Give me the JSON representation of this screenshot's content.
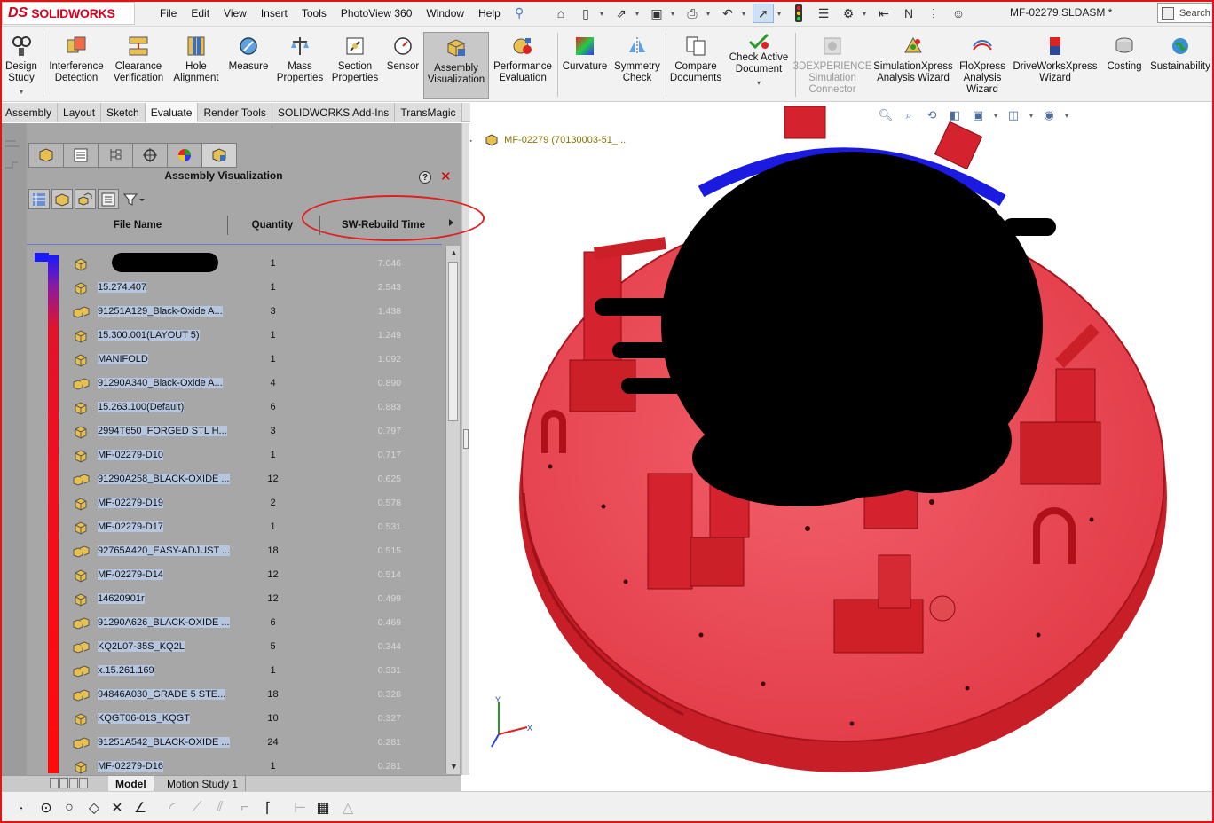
{
  "app": {
    "logo_prefix": "DS",
    "logo_text": "SOLIDWORKS",
    "doc_title": "MF-02279.SLDASM *",
    "search_label": "Search"
  },
  "menu": [
    "File",
    "Edit",
    "View",
    "Insert",
    "Tools",
    "PhotoView 360",
    "Window",
    "Help"
  ],
  "commands": [
    {
      "label": "Design\nStudy",
      "icon": "design-study-icon"
    },
    {
      "label": "Interference\nDetection",
      "icon": "interference-detection-icon"
    },
    {
      "label": "Clearance\nVerification",
      "icon": "clearance-verification-icon"
    },
    {
      "label": "Hole\nAlignment",
      "icon": "hole-alignment-icon"
    },
    {
      "label": "Measure",
      "icon": "measure-icon"
    },
    {
      "label": "Mass\nProperties",
      "icon": "mass-properties-icon"
    },
    {
      "label": "Section\nProperties",
      "icon": "section-properties-icon"
    },
    {
      "label": "Sensor",
      "icon": "sensor-icon"
    },
    {
      "label": "Assembly\nVisualization",
      "icon": "assembly-visualization-icon"
    },
    {
      "label": "Performance\nEvaluation",
      "icon": "performance-evaluation-icon"
    },
    {
      "label": "Curvature",
      "icon": "curvature-icon"
    },
    {
      "label": "Symmetry\nCheck",
      "icon": "symmetry-check-icon"
    },
    {
      "label": "Compare\nDocuments",
      "icon": "compare-documents-icon"
    },
    {
      "label": "Check Active\nDocument",
      "icon": "check-active-document-icon"
    },
    {
      "label": "3DEXPERIENCE\nSimulation\nConnector",
      "icon": "3dexperience-icon"
    },
    {
      "label": "SimulationXpress\nAnalysis Wizard",
      "icon": "simulationxpress-icon"
    },
    {
      "label": "FloXpress\nAnalysis\nWizard",
      "icon": "floxpress-icon"
    },
    {
      "label": "DriveWorksXpress\nWizard",
      "icon": "driveworksxpress-icon"
    },
    {
      "label": "Costing",
      "icon": "costing-icon"
    },
    {
      "label": "Sustainability",
      "icon": "sustainability-icon"
    }
  ],
  "tabs": [
    "Assembly",
    "Layout",
    "Sketch",
    "Evaluate",
    "Render Tools",
    "SOLIDWORKS Add-Ins",
    "TransMagic"
  ],
  "panel": {
    "title": "Assembly Visualization",
    "help": "?",
    "close": "✕",
    "columns": {
      "name": "File Name",
      "qty": "Quantity",
      "time": "SW-Rebuild Time"
    }
  },
  "rows": [
    {
      "name": "",
      "qty": "1",
      "time": "7.046"
    },
    {
      "name": "15.274.407",
      "qty": "1",
      "time": "2.543"
    },
    {
      "name": "91251A129_Black-Oxide A...",
      "qty": "3",
      "time": "1.438"
    },
    {
      "name": "15.300.001(LAYOUT 5)",
      "qty": "1",
      "time": "1.249"
    },
    {
      "name": "MANIFOLD",
      "qty": "1",
      "time": "1.092"
    },
    {
      "name": "91290A340_Black-Oxide A...",
      "qty": "4",
      "time": "0.890"
    },
    {
      "name": "15.263.100(Default)",
      "qty": "6",
      "time": "0.883"
    },
    {
      "name": "2994T650_FORGED STL H...",
      "qty": "3",
      "time": "0.797"
    },
    {
      "name": "MF-02279-D10",
      "qty": "1",
      "time": "0.717"
    },
    {
      "name": "91290A258_BLACK-OXIDE ...",
      "qty": "12",
      "time": "0.625"
    },
    {
      "name": "MF-02279-D19",
      "qty": "2",
      "time": "0.578"
    },
    {
      "name": "MF-02279-D17",
      "qty": "1",
      "time": "0.531"
    },
    {
      "name": "92765A420_EASY-ADJUST ...",
      "qty": "18",
      "time": "0.515"
    },
    {
      "name": "MF-02279-D14",
      "qty": "12",
      "time": "0.514"
    },
    {
      "name": "14620901r",
      "qty": "12",
      "time": "0.499"
    },
    {
      "name": "91290A626_BLACK-OXIDE ...",
      "qty": "6",
      "time": "0.469"
    },
    {
      "name": "KQ2L07-35S_KQ2L",
      "qty": "5",
      "time": "0.344"
    },
    {
      "name": "x.15.261.169",
      "qty": "1",
      "time": "0.331"
    },
    {
      "name": "94846A030_GRADE 5 STE...",
      "qty": "18",
      "time": "0.328"
    },
    {
      "name": "KQGT06-01S_KQGT",
      "qty": "10",
      "time": "0.327"
    },
    {
      "name": "91251A542_BLACK-OXIDE ...",
      "qty": "24",
      "time": "0.281"
    },
    {
      "name": "MF-02279-D16",
      "qty": "1",
      "time": "0.281"
    }
  ],
  "bottom_tabs": [
    "Model",
    "Motion Study 1"
  ],
  "viewport": {
    "tree_label": "MF-02279  (70130003-51_...",
    "triad_x": "X",
    "triad_y": "Y"
  }
}
